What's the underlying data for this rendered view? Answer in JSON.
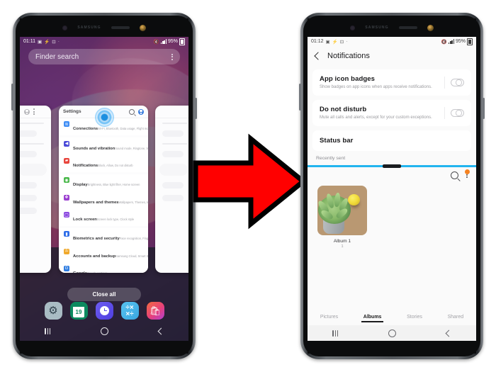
{
  "left_phone": {
    "device_brand": "SAMSUNG",
    "status_bar": {
      "time": "01:11",
      "battery": "95%"
    },
    "finder": {
      "placeholder": "Finder search"
    },
    "recents": {
      "close_all_label": "Close all",
      "card_title": "Settings",
      "settings_items": [
        {
          "name": "Connections",
          "sub": "Wi-Fi, Bluetooth, Data usage, Flight mode",
          "icon": "wifi-icon",
          "color": "#3f8ef5"
        },
        {
          "name": "Sounds and vibration",
          "sub": "Sound mode, Ringtone, Volume",
          "icon": "sound-icon",
          "color": "#4a4ad8"
        },
        {
          "name": "Notifications",
          "sub": "Block, Allow, Do not disturb",
          "icon": "bell-icon",
          "color": "#e8453c"
        },
        {
          "name": "Display",
          "sub": "Brightness, Blue light filter, Home screen",
          "icon": "display-icon",
          "color": "#49b84a"
        },
        {
          "name": "Wallpapers and themes",
          "sub": "Wallpapers, Themes, Icons",
          "icon": "wallpaper-icon",
          "color": "#9b3fd0"
        },
        {
          "name": "Lock screen",
          "sub": "Screen lock type, Clock style",
          "icon": "lock-icon",
          "color": "#8c4ae0"
        },
        {
          "name": "Biometrics and security",
          "sub": "Face recognition, Fingerprints, Privacy",
          "icon": "fingerprint-icon",
          "color": "#2f6ee8"
        },
        {
          "name": "Accounts and backup",
          "sub": "Samsung Cloud, Smart Switch",
          "icon": "key-icon",
          "color": "#f0a92c"
        },
        {
          "name": "Google",
          "sub": "Google settings",
          "icon": "google-icon",
          "color": "#2f7de1"
        }
      ]
    },
    "dock": [
      {
        "label": "Settings",
        "icon": "gear-icon",
        "color": "#a9bcc4"
      },
      {
        "label": "Calendar",
        "icon": "calendar-icon",
        "color": "#0c8a5f",
        "day": "19"
      },
      {
        "label": "Clock",
        "icon": "clock-icon",
        "color": "#5b50e8"
      },
      {
        "label": "Calculator",
        "icon": "calculator-icon",
        "color": "#45b7e8"
      },
      {
        "label": "Galaxy Store",
        "icon": "shopping-bag-icon",
        "color": "#e8417a"
      }
    ],
    "nav_bar": [
      {
        "label": "Recents",
        "icon": "recents-icon"
      },
      {
        "label": "Home",
        "icon": "home-circle-icon"
      },
      {
        "label": "Back",
        "icon": "back-chevron-icon"
      }
    ]
  },
  "right_phone": {
    "device_brand": "SAMSUNG",
    "status_bar": {
      "time": "01:12",
      "battery": "95%"
    },
    "app_bar": {
      "title": "Notifications",
      "back_icon": "back-chevron-icon"
    },
    "settings": [
      {
        "title": "App icon badges",
        "desc": "Show badges on app icons when apps receive notifications.",
        "toggle": "off"
      },
      {
        "title": "Do not disturb",
        "desc": "Mute all calls and alerts, except for your custom exceptions.",
        "toggle": "off"
      },
      {
        "title": "Status bar",
        "desc": "",
        "toggle": "none"
      }
    ],
    "recently_sent_label": "Recently sent",
    "gallery": {
      "search_icon": "search-icon",
      "menu_icon": "more-options-icon",
      "badge_icon": "notification-badge",
      "album": {
        "name": "Album 1",
        "count": "1"
      },
      "tabs": [
        {
          "label": "Pictures",
          "active": false
        },
        {
          "label": "Albums",
          "active": true
        },
        {
          "label": "Stories",
          "active": false
        },
        {
          "label": "Shared",
          "active": false
        }
      ]
    },
    "nav_bar": [
      {
        "label": "Recents",
        "icon": "recents-icon"
      },
      {
        "label": "Home",
        "icon": "home-circle-icon"
      },
      {
        "label": "Back",
        "icon": "back-chevron-icon"
      }
    ]
  },
  "arrow": {
    "name": "red-right-arrow",
    "fill": "#FF0000",
    "stroke": "#000000",
    "direction": "right"
  }
}
